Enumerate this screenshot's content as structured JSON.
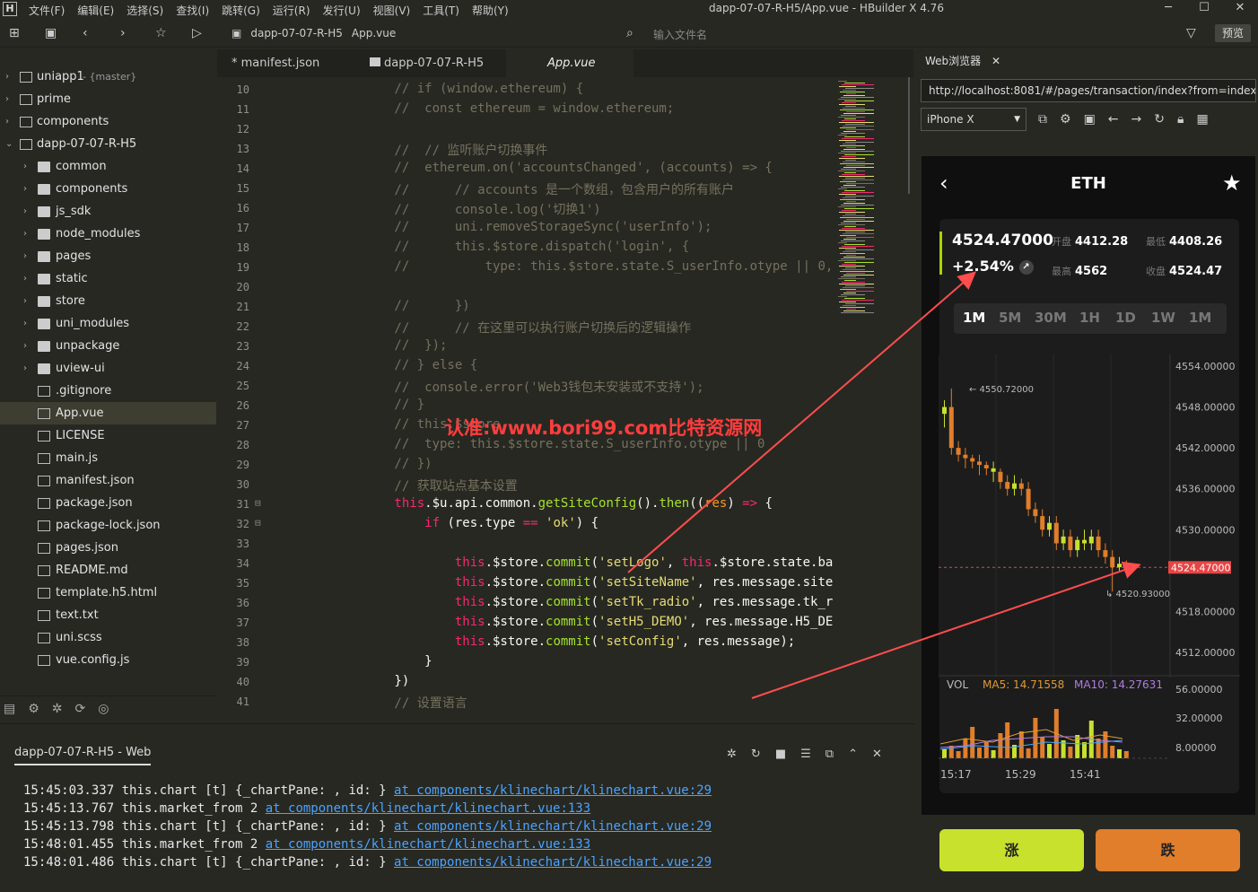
{
  "titlebar": {
    "menus": [
      "文件(F)",
      "编辑(E)",
      "选择(S)",
      "查找(I)",
      "跳转(G)",
      "运行(R)",
      "发行(U)",
      "视图(V)",
      "工具(T)",
      "帮助(Y)"
    ],
    "title": "dapp-07-07-R-H5/App.vue - HBuilder X 4.76"
  },
  "toolbar": {
    "crumb1": "dapp-07-07-R-H5",
    "crumb2": "App.vue",
    "file_input_placeholder": "输入文件名",
    "preview_label": "预览"
  },
  "sidebar": {
    "items": [
      {
        "label": "uniapp1",
        "extra": "- {master}",
        "depth": 0,
        "kind": "project"
      },
      {
        "label": "prime",
        "depth": 0,
        "kind": "project"
      },
      {
        "label": "components",
        "depth": 0,
        "kind": "project"
      },
      {
        "label": "dapp-07-07-R-H5",
        "depth": 0,
        "kind": "project-open"
      },
      {
        "label": "common",
        "depth": 1,
        "kind": "folder"
      },
      {
        "label": "components",
        "depth": 1,
        "kind": "folder"
      },
      {
        "label": "js_sdk",
        "depth": 1,
        "kind": "folder"
      },
      {
        "label": "node_modules",
        "depth": 1,
        "kind": "folder"
      },
      {
        "label": "pages",
        "depth": 1,
        "kind": "folder"
      },
      {
        "label": "static",
        "depth": 1,
        "kind": "folder"
      },
      {
        "label": "store",
        "depth": 1,
        "kind": "folder"
      },
      {
        "label": "uni_modules",
        "depth": 1,
        "kind": "folder"
      },
      {
        "label": "unpackage",
        "depth": 1,
        "kind": "folder"
      },
      {
        "label": "uview-ui",
        "depth": 1,
        "kind": "folder"
      },
      {
        "label": ".gitignore",
        "depth": 1,
        "kind": "file"
      },
      {
        "label": "App.vue",
        "depth": 1,
        "kind": "file",
        "selected": true
      },
      {
        "label": "LICENSE",
        "depth": 1,
        "kind": "file"
      },
      {
        "label": "main.js",
        "depth": 1,
        "kind": "file"
      },
      {
        "label": "manifest.json",
        "depth": 1,
        "kind": "file"
      },
      {
        "label": "package.json",
        "depth": 1,
        "kind": "file"
      },
      {
        "label": "package-lock.json",
        "depth": 1,
        "kind": "file"
      },
      {
        "label": "pages.json",
        "depth": 1,
        "kind": "file"
      },
      {
        "label": "README.md",
        "depth": 1,
        "kind": "file"
      },
      {
        "label": "template.h5.html",
        "depth": 1,
        "kind": "file"
      },
      {
        "label": "text.txt",
        "depth": 1,
        "kind": "file"
      },
      {
        "label": "uni.scss",
        "depth": 1,
        "kind": "file"
      },
      {
        "label": "vue.config.js",
        "depth": 1,
        "kind": "file"
      }
    ]
  },
  "tabs": [
    {
      "label": "* manifest.json"
    },
    {
      "label": "dapp-07-07-R-H5"
    },
    {
      "label": "App.vue"
    }
  ],
  "editor": {
    "lines": [
      {
        "n": "10",
        "segs": [
          [
            "c",
            "        // if (window.ethereum) {"
          ]
        ]
      },
      {
        "n": "11",
        "segs": [
          [
            "c",
            "        //  const ethereum = window.ethereum;"
          ]
        ]
      },
      {
        "n": "12",
        "segs": [
          [
            "c",
            ""
          ]
        ]
      },
      {
        "n": "13",
        "segs": [
          [
            "c",
            "        //  // 监听账户切换事件"
          ]
        ]
      },
      {
        "n": "14",
        "segs": [
          [
            "c",
            "        //  ethereum.on('accountsChanged', (accounts) => {"
          ]
        ]
      },
      {
        "n": "15",
        "segs": [
          [
            "c",
            "        //      // accounts 是一个数组，包含用户的所有账户"
          ]
        ]
      },
      {
        "n": "16",
        "segs": [
          [
            "c",
            "        //      console.log('切换1')"
          ]
        ]
      },
      {
        "n": "17",
        "segs": [
          [
            "c",
            "        //      uni.removeStorageSync('userInfo');"
          ]
        ]
      },
      {
        "n": "18",
        "segs": [
          [
            "c",
            "        //      this.$store.dispatch('login', {"
          ]
        ]
      },
      {
        "n": "19",
        "segs": [
          [
            "c",
            "        //          type: this.$store.state.S_userInfo.otype || 0,"
          ]
        ]
      },
      {
        "n": "20",
        "segs": [
          [
            "c",
            ""
          ]
        ]
      },
      {
        "n": "21",
        "segs": [
          [
            "c",
            "        //      })"
          ]
        ]
      },
      {
        "n": "22",
        "segs": [
          [
            "c",
            "        //      // 在这里可以执行账户切换后的逻辑操作"
          ]
        ]
      },
      {
        "n": "23",
        "segs": [
          [
            "c",
            "        //  });"
          ]
        ]
      },
      {
        "n": "24",
        "segs": [
          [
            "c",
            "        // } else {"
          ]
        ]
      },
      {
        "n": "25",
        "segs": [
          [
            "c",
            "        //  console.error('Web3钱包未安装或不支持');"
          ]
        ]
      },
      {
        "n": "26",
        "segs": [
          [
            "c",
            "        // }"
          ]
        ]
      },
      {
        "n": "27",
        "segs": [
          [
            "c",
            "        // this.$store"
          ]
        ]
      },
      {
        "n": "28",
        "segs": [
          [
            "c",
            "        //  type: this.$store.state.S_userInfo.otype || 0"
          ]
        ]
      },
      {
        "n": "29",
        "segs": [
          [
            "c",
            "        // })"
          ]
        ]
      },
      {
        "n": "30",
        "segs": [
          [
            "c",
            "        // 获取站点基本设置"
          ]
        ]
      },
      {
        "n": "31",
        "segs": [
          [
            "th",
            "        this"
          ],
          [
            "pl",
            ".$u.api.common."
          ],
          [
            "f",
            "getSiteConfig"
          ],
          [
            "pl",
            "()."
          ],
          [
            "f",
            "then"
          ],
          [
            "pl",
            "(("
          ],
          [
            "t",
            "res"
          ],
          [
            "pl",
            ") "
          ],
          [
            "k",
            "=>"
          ],
          [
            "pl",
            " {"
          ]
        ]
      },
      {
        "n": "32",
        "segs": [
          [
            "k",
            "            if"
          ],
          [
            "pl",
            " (res.type "
          ],
          [
            "k",
            "=="
          ],
          [
            "pl",
            " "
          ],
          [
            "s",
            "'ok'"
          ],
          [
            "pl",
            ") {"
          ]
        ]
      },
      {
        "n": "33",
        "segs": [
          [
            "pl",
            ""
          ]
        ]
      },
      {
        "n": "34",
        "segs": [
          [
            "th",
            "                this"
          ],
          [
            "pl",
            ".$store."
          ],
          [
            "f",
            "commit"
          ],
          [
            "pl",
            "("
          ],
          [
            "s",
            "'setLogo'"
          ],
          [
            "pl",
            ", "
          ],
          [
            "th",
            "this"
          ],
          [
            "pl",
            ".$store.state.ba"
          ]
        ]
      },
      {
        "n": "35",
        "segs": [
          [
            "th",
            "                this"
          ],
          [
            "pl",
            ".$store."
          ],
          [
            "f",
            "commit"
          ],
          [
            "pl",
            "("
          ],
          [
            "s",
            "'setSiteName'"
          ],
          [
            "pl",
            ", res.message.site"
          ]
        ]
      },
      {
        "n": "36",
        "segs": [
          [
            "th",
            "                this"
          ],
          [
            "pl",
            ".$store."
          ],
          [
            "f",
            "commit"
          ],
          [
            "pl",
            "("
          ],
          [
            "s",
            "'setTk_radio'"
          ],
          [
            "pl",
            ", res.message.tk_r"
          ]
        ]
      },
      {
        "n": "37",
        "segs": [
          [
            "th",
            "                this"
          ],
          [
            "pl",
            ".$store."
          ],
          [
            "f",
            "commit"
          ],
          [
            "pl",
            "("
          ],
          [
            "s",
            "'setH5_DEMO'"
          ],
          [
            "pl",
            ", res.message.H5_DE"
          ]
        ]
      },
      {
        "n": "38",
        "segs": [
          [
            "th",
            "                this"
          ],
          [
            "pl",
            ".$store."
          ],
          [
            "f",
            "commit"
          ],
          [
            "pl",
            "("
          ],
          [
            "s",
            "'setConfig'"
          ],
          [
            "pl",
            ", res.message);"
          ]
        ]
      },
      {
        "n": "39",
        "segs": [
          [
            "pl",
            "            }"
          ]
        ]
      },
      {
        "n": "40",
        "segs": [
          [
            "pl",
            "        })"
          ]
        ]
      },
      {
        "n": "41",
        "segs": [
          [
            "c",
            "        // 设置语言"
          ]
        ]
      }
    ]
  },
  "browser": {
    "tab_label": "Web浏览器",
    "url": "http://localhost:8081/#/pages/transaction/index?from=index&",
    "device": "iPhone X"
  },
  "phone": {
    "title": "ETH",
    "price": "4524.47000",
    "change": "+2.54%",
    "open_label": "开盘",
    "open": "4412.28",
    "low_label": "最低",
    "low": "4408.26",
    "high_label": "最高",
    "high": "4562",
    "close_label": "收盘",
    "close": "4524.47",
    "periods": [
      "1M",
      "5M",
      "30M",
      "1H",
      "1D",
      "1W",
      "1M"
    ],
    "y_labels": [
      "4554.00000",
      "4548.00000",
      "4542.00000",
      "4536.00000",
      "4530.00000",
      "4524.47000",
      "4518.00000",
      "4512.00000"
    ],
    "max_label": "4550.72000",
    "min_label": "4520.93000",
    "current_label": "4524.47000",
    "vol": "VOL",
    "ma5": "MA5: 14.71558",
    "ma10": "MA10: 14.27631",
    "vol_labels": [
      "56.00000",
      "32.00000",
      "8.00000"
    ],
    "times": [
      "15:17",
      "15:29",
      "15:41"
    ],
    "buy": "涨",
    "sell": "跌",
    "colors": {
      "up": "#c7e12d",
      "down": "#e07e2b"
    }
  },
  "watermark": "认准:www.bori99.com比特资源网",
  "console": {
    "tab": "dapp-07-07-R-H5 - Web",
    "logs": [
      {
        "t": "15:45:03.337",
        "msg": "this.chart [t] {_chartPane: , id: }",
        "link": "at components/klinechart/klinechart.vue:29"
      },
      {
        "t": "15:45:13.767",
        "msg": "this.market_from 2",
        "link": "at components/klinechart/klinechart.vue:133"
      },
      {
        "t": "15:45:13.798",
        "msg": "this.chart [t] {_chartPane: , id: }",
        "link": "at components/klinechart/klinechart.vue:29"
      },
      {
        "t": "15:48:01.455",
        "msg": "this.market_from 2",
        "link": "at components/klinechart/klinechart.vue:133"
      },
      {
        "t": "15:48:01.486",
        "msg": "this.chart [t] {_chartPane: , id: }",
        "link": "at components/klinechart/klinechart.vue:29"
      }
    ]
  }
}
